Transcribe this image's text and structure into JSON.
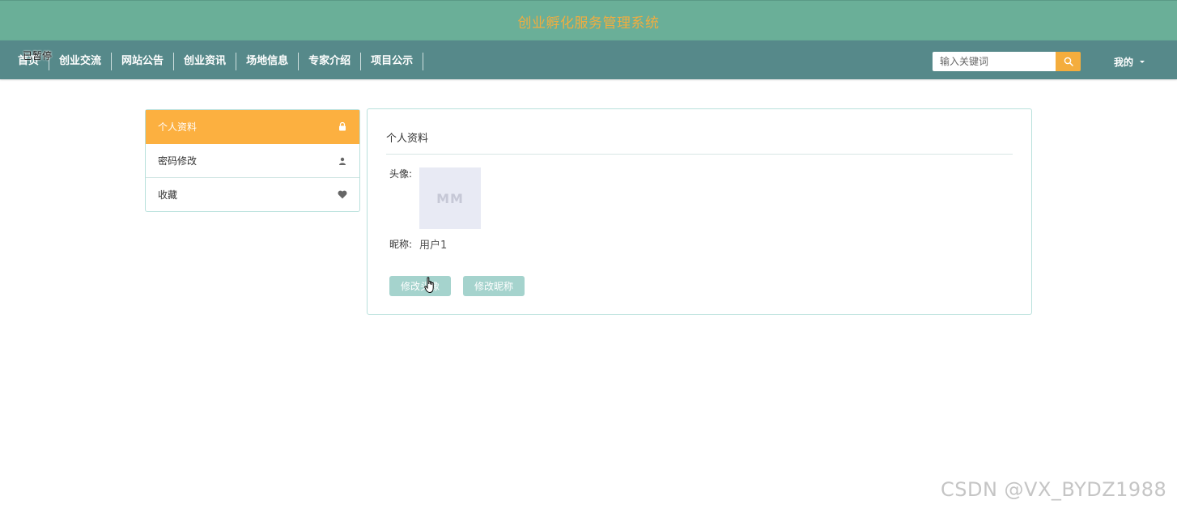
{
  "header": {
    "title": "创业孵化服务管理系统"
  },
  "nav": {
    "items": [
      {
        "label": "首页"
      },
      {
        "label": "创业交流"
      },
      {
        "label": "网站公告"
      },
      {
        "label": "创业资讯"
      },
      {
        "label": "场地信息"
      },
      {
        "label": "专家介绍"
      },
      {
        "label": "项目公示"
      }
    ],
    "paused_overlay": "已暂停",
    "search": {
      "placeholder": "输入关键词",
      "icon": "search-icon"
    },
    "user_menu": "我的"
  },
  "sidebar": {
    "items": [
      {
        "label": "个人资料",
        "icon": "lock-icon",
        "active": true
      },
      {
        "label": "密码修改",
        "icon": "user-icon",
        "active": false
      },
      {
        "label": "收藏",
        "icon": "heart-icon",
        "active": false
      }
    ]
  },
  "profile": {
    "title": "个人资料",
    "avatar_label": "头像:",
    "avatar_placeholder": "MM",
    "nickname_label": "昵称:",
    "nickname_value": "用户1",
    "buttons": {
      "change_avatar": "修改头像",
      "change_nickname": "修改昵称"
    }
  },
  "watermark": "CSDN @VX_BYDZ1988",
  "colors": {
    "header_bg": "#6aaf98",
    "title_color": "#f1ad3f",
    "navbar_bg": "#56898a",
    "accent_orange": "#fcb040",
    "button_teal": "#a5d3cd"
  }
}
